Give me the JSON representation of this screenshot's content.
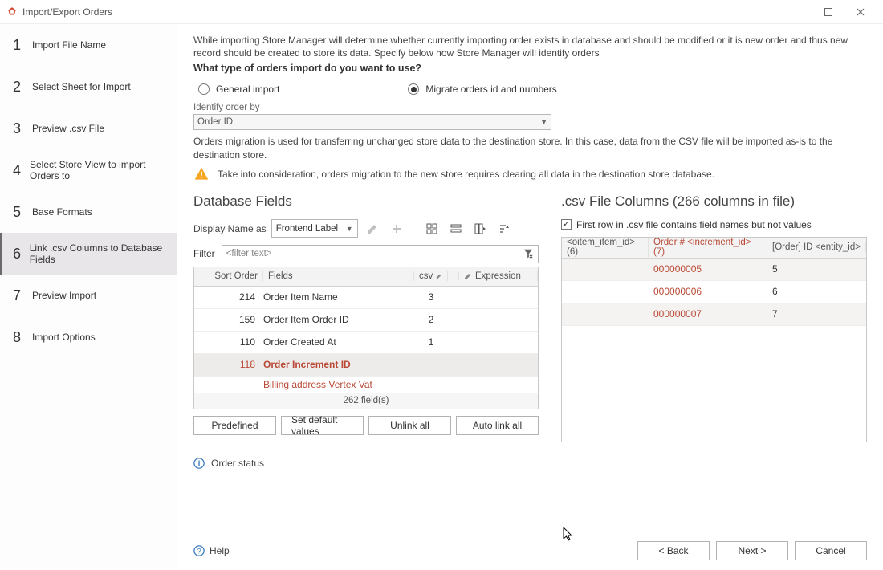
{
  "window": {
    "title": "Import/Export Orders"
  },
  "steps": [
    {
      "num": "1",
      "label": "Import File Name"
    },
    {
      "num": "2",
      "label": "Select Sheet for Import"
    },
    {
      "num": "3",
      "label": "Preview .csv File"
    },
    {
      "num": "4",
      "label": "Select Store View to import Orders to"
    },
    {
      "num": "5",
      "label": "Base Formats"
    },
    {
      "num": "6",
      "label": "Link .csv Columns to Database Fields"
    },
    {
      "num": "7",
      "label": "Preview Import"
    },
    {
      "num": "8",
      "label": "Import Options"
    }
  ],
  "intro": "While importing Store Manager will determine whether currently importing order exists in database and should be modified or it is new order and thus new record should be created to store its data. Specify below how Store Manager will identify orders",
  "question": "What type of orders import do you want to use?",
  "radios": {
    "general": "General import",
    "migrate": "Migrate orders id and numbers"
  },
  "identify": {
    "label": "Identify order by",
    "value": "Order ID"
  },
  "note": "Orders migration is used for transferring unchanged store data to the destination store. In this case, data from the CSV file will be imported as-is to the destination store.",
  "warning": "Take into consideration, orders migration to the new store requires clearing all data in the destination store database.",
  "dbfields": {
    "title": "Database Fields",
    "displayNameAs": "Display Name as",
    "displayNameValue": "Frontend Label",
    "filterLabel": "Filter",
    "filterPlaceholder": "<filter text>",
    "headers": {
      "sort": "Sort Order",
      "fields": "Fields",
      "csv": "csv",
      "exp": "Expression"
    },
    "rows": [
      {
        "sort": "214",
        "fields": "Order Item Name",
        "csv": "3"
      },
      {
        "sort": "159",
        "fields": "Order Item Order ID",
        "csv": "2"
      },
      {
        "sort": "110",
        "fields": "Order Created At",
        "csv": "1"
      },
      {
        "sort": "118",
        "fields": "Order Increment ID",
        "csv": "",
        "selected": true
      },
      {
        "sort": "",
        "fields": "Billing address Vertex Vat",
        "csv": "",
        "partial": true
      }
    ],
    "footer": "262 field(s)",
    "buttons": {
      "predefined": "Predefined",
      "setDefault": "Set default values",
      "unlink": "Unlink all",
      "autolink": "Auto link all"
    }
  },
  "csvcols": {
    "title": ".csv File Columns (266 columns in file)",
    "checkbox": "First row in .csv file contains field names but not values",
    "headers": {
      "c1": "<oitem_item_id> (6)",
      "c2": "Order # <increment_id> (7)",
      "c3": "[Order] ID <entity_id>"
    },
    "rows": [
      {
        "c1": "",
        "c2": "000000005",
        "c3": "5"
      },
      {
        "c1": "",
        "c2": "000000006",
        "c3": "6"
      },
      {
        "c1": "",
        "c2": "000000007",
        "c3": "7"
      }
    ]
  },
  "status": "Order status",
  "footerBtns": {
    "help": "Help",
    "back": "< Back",
    "next": "Next >",
    "cancel": "Cancel"
  }
}
